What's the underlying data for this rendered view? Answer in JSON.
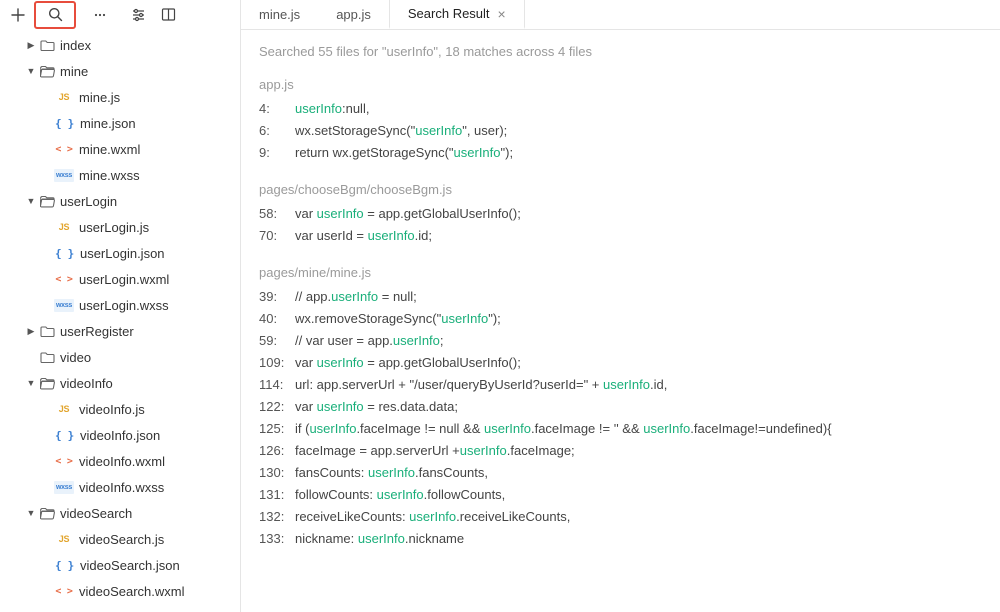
{
  "toolbar": {
    "icons": [
      "plus",
      "search",
      "dots",
      "sliders",
      "split"
    ]
  },
  "tree": [
    {
      "depth": 1,
      "twist": "▶",
      "kind": "folder",
      "label": "index"
    },
    {
      "depth": 1,
      "twist": "▼",
      "kind": "folder-open",
      "label": "mine"
    },
    {
      "depth": 2,
      "twist": "",
      "kind": "js",
      "label": "mine.js"
    },
    {
      "depth": 2,
      "twist": "",
      "kind": "json",
      "label": "mine.json"
    },
    {
      "depth": 2,
      "twist": "",
      "kind": "wxml",
      "label": "mine.wxml"
    },
    {
      "depth": 2,
      "twist": "",
      "kind": "wxss",
      "label": "mine.wxss"
    },
    {
      "depth": 1,
      "twist": "▼",
      "kind": "folder-open",
      "label": "userLogin"
    },
    {
      "depth": 2,
      "twist": "",
      "kind": "js",
      "label": "userLogin.js"
    },
    {
      "depth": 2,
      "twist": "",
      "kind": "json",
      "label": "userLogin.json"
    },
    {
      "depth": 2,
      "twist": "",
      "kind": "wxml",
      "label": "userLogin.wxml"
    },
    {
      "depth": 2,
      "twist": "",
      "kind": "wxss",
      "label": "userLogin.wxss"
    },
    {
      "depth": 1,
      "twist": "▶",
      "kind": "folder",
      "label": "userRegister"
    },
    {
      "depth": 1,
      "twist": "",
      "kind": "folder",
      "label": "video"
    },
    {
      "depth": 1,
      "twist": "▼",
      "kind": "folder-open",
      "label": "videoInfo"
    },
    {
      "depth": 2,
      "twist": "",
      "kind": "js",
      "label": "videoInfo.js"
    },
    {
      "depth": 2,
      "twist": "",
      "kind": "json",
      "label": "videoInfo.json"
    },
    {
      "depth": 2,
      "twist": "",
      "kind": "wxml",
      "label": "videoInfo.wxml"
    },
    {
      "depth": 2,
      "twist": "",
      "kind": "wxss",
      "label": "videoInfo.wxss"
    },
    {
      "depth": 1,
      "twist": "▼",
      "kind": "folder-open",
      "label": "videoSearch"
    },
    {
      "depth": 2,
      "twist": "",
      "kind": "js",
      "label": "videoSearch.js"
    },
    {
      "depth": 2,
      "twist": "",
      "kind": "json",
      "label": "videoSearch.json"
    },
    {
      "depth": 2,
      "twist": "",
      "kind": "wxml",
      "label": "videoSearch.wxml"
    }
  ],
  "tabs": [
    {
      "label": "mine.js",
      "active": false
    },
    {
      "label": "app.js",
      "active": false
    },
    {
      "label": "Search Result",
      "active": true
    }
  ],
  "summary": "Searched 55 files for \"userInfo\", 18 matches across 4 files",
  "results": [
    {
      "file": "app.js",
      "lines": [
        {
          "n": "4:",
          "segs": [
            {
              "t": "userInfo",
              "h": 1
            },
            {
              "t": ":null,"
            }
          ]
        },
        {
          "n": "6:",
          "segs": [
            {
              "t": "wx.setStorageSync(\""
            },
            {
              "t": "userInfo",
              "h": 1
            },
            {
              "t": "\", user);"
            }
          ]
        },
        {
          "n": "9:",
          "segs": [
            {
              "t": "return wx.getStorageSync(\""
            },
            {
              "t": "userInfo",
              "h": 1
            },
            {
              "t": "\");"
            }
          ]
        }
      ]
    },
    {
      "file": "pages/chooseBgm/chooseBgm.js",
      "lines": [
        {
          "n": "58:",
          "segs": [
            {
              "t": "var "
            },
            {
              "t": "userInfo",
              "h": 1
            },
            {
              "t": " = app.getGlobalUserInfo();"
            }
          ]
        },
        {
          "n": "70:",
          "segs": [
            {
              "t": "var userId = "
            },
            {
              "t": "userInfo",
              "h": 1
            },
            {
              "t": ".id;"
            }
          ]
        }
      ]
    },
    {
      "file": "pages/mine/mine.js",
      "lines": [
        {
          "n": "39:",
          "segs": [
            {
              "t": "// app."
            },
            {
              "t": "userInfo",
              "h": 1
            },
            {
              "t": " = null;"
            }
          ]
        },
        {
          "n": "40:",
          "segs": [
            {
              "t": "wx.removeStorageSync(\""
            },
            {
              "t": "userInfo",
              "h": 1
            },
            {
              "t": "\");"
            }
          ]
        },
        {
          "n": "59:",
          "segs": [
            {
              "t": "// var user = app."
            },
            {
              "t": "userInfo",
              "h": 1
            },
            {
              "t": ";"
            }
          ]
        },
        {
          "n": "109:",
          "segs": [
            {
              "t": "var "
            },
            {
              "t": "userInfo",
              "h": 1
            },
            {
              "t": " = app.getGlobalUserInfo();"
            }
          ]
        },
        {
          "n": "114:",
          "segs": [
            {
              "t": "url: app.serverUrl + \"/user/queryByUserId?userId=\" + "
            },
            {
              "t": "userInfo",
              "h": 1
            },
            {
              "t": ".id,"
            }
          ]
        },
        {
          "n": "122:",
          "segs": [
            {
              "t": "var "
            },
            {
              "t": "userInfo",
              "h": 1
            },
            {
              "t": " = res.data.data;"
            }
          ]
        },
        {
          "n": "125:",
          "segs": [
            {
              "t": "if ("
            },
            {
              "t": "userInfo",
              "h": 1
            },
            {
              "t": ".faceImage != null && "
            },
            {
              "t": "userInfo",
              "h": 1
            },
            {
              "t": ".faceImage != '' && "
            },
            {
              "t": "userInfo",
              "h": 1
            },
            {
              "t": ".faceImage!=undefined){"
            }
          ]
        },
        {
          "n": "126:",
          "segs": [
            {
              "t": "faceImage = app.serverUrl +"
            },
            {
              "t": "userInfo",
              "h": 1
            },
            {
              "t": ".faceImage;"
            }
          ]
        },
        {
          "n": "130:",
          "segs": [
            {
              "t": "fansCounts: "
            },
            {
              "t": "userInfo",
              "h": 1
            },
            {
              "t": ".fansCounts,"
            }
          ]
        },
        {
          "n": "131:",
          "segs": [
            {
              "t": "followCounts: "
            },
            {
              "t": "userInfo",
              "h": 1
            },
            {
              "t": ".followCounts,"
            }
          ]
        },
        {
          "n": "132:",
          "segs": [
            {
              "t": "receiveLikeCounts: "
            },
            {
              "t": "userInfo",
              "h": 1
            },
            {
              "t": ".receiveLikeCounts,"
            }
          ]
        },
        {
          "n": "133:",
          "segs": [
            {
              "t": "nickname: "
            },
            {
              "t": "userInfo",
              "h": 1
            },
            {
              "t": ".nickname"
            }
          ]
        }
      ]
    }
  ],
  "fileIcons": {
    "js": "JS",
    "json": "{ }",
    "wxml": "< >",
    "wxss": "wxss"
  }
}
